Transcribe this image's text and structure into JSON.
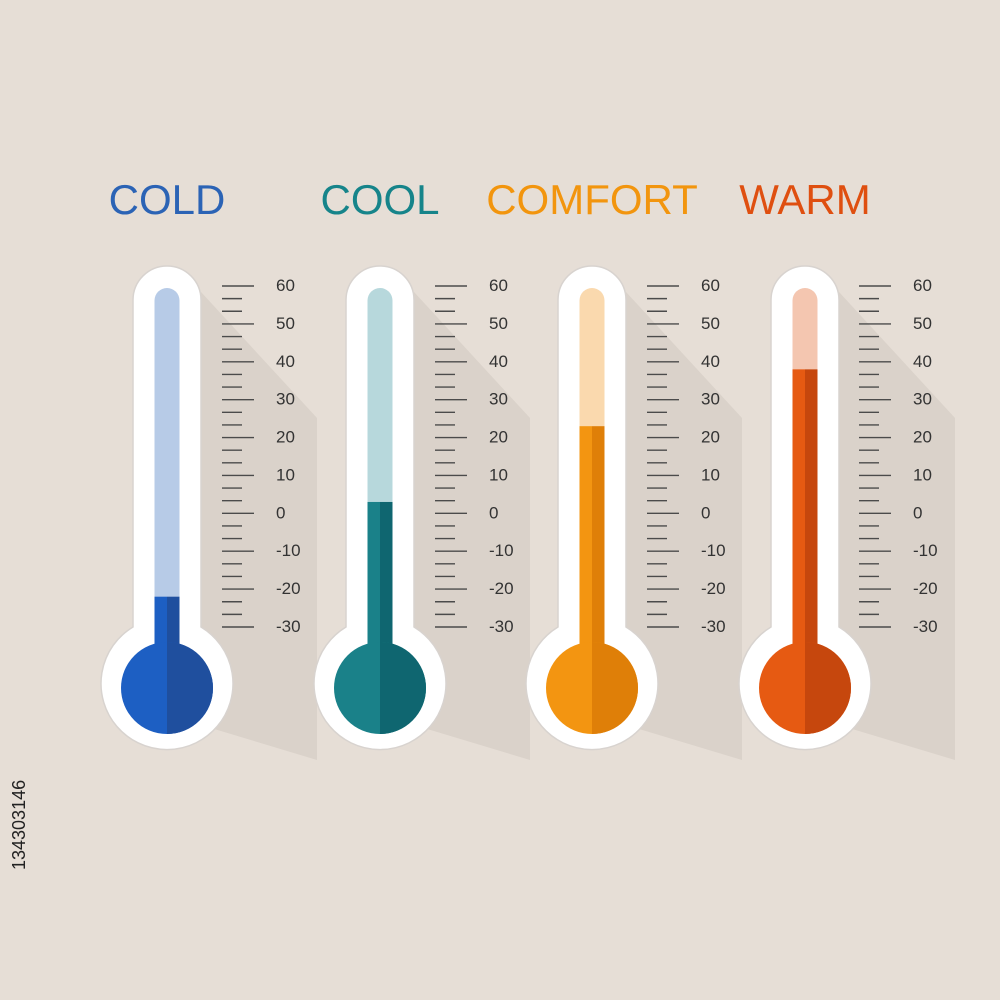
{
  "scale": {
    "min": -30,
    "max": 60,
    "tick_labels": [
      "60",
      "50",
      "40",
      "30",
      "20",
      "10",
      "0",
      "-10",
      "-20",
      "-30"
    ]
  },
  "thermometers": [
    {
      "label": "COLD",
      "value": -22,
      "colors": {
        "label": "#2b63b5",
        "fill_main": "#1d5fc3",
        "fill_shadow": "#1f4f9e",
        "tube_light": "#b7cbe7"
      }
    },
    {
      "label": "COOL",
      "value": 3,
      "colors": {
        "label": "#16848a",
        "fill_main": "#1a8189",
        "fill_shadow": "#0f6670",
        "tube_light": "#b7d8dc"
      }
    },
    {
      "label": "COMFORT",
      "value": 23,
      "colors": {
        "label": "#f2950e",
        "fill_main": "#f39511",
        "fill_shadow": "#df7f08",
        "tube_light": "#fad9ae"
      }
    },
    {
      "label": "WARM",
      "value": 38,
      "colors": {
        "label": "#df4f10",
        "fill_main": "#e65a12",
        "fill_shadow": "#c6470d",
        "tube_light": "#f4c6b0"
      }
    }
  ],
  "side_id": "134303146"
}
